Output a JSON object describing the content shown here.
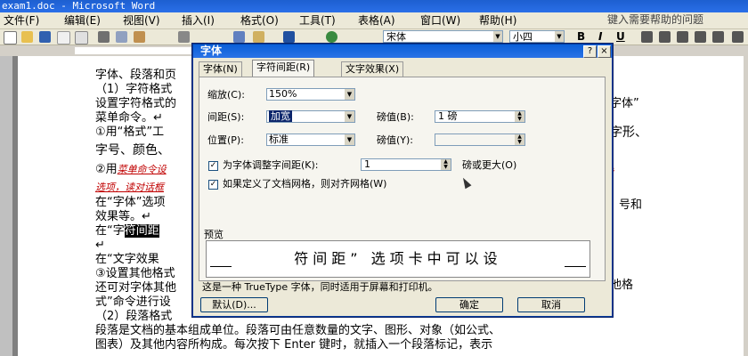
{
  "window": {
    "title": "exam1.doc - Microsoft Word"
  },
  "menu": {
    "items": [
      "文件(F)",
      "编辑(E)",
      "视图(V)",
      "插入(I)",
      "格式(O)",
      "工具(T)",
      "表格(A)",
      "窗口(W)",
      "帮助(H)"
    ],
    "help_placeholder": "键入需要帮助的问题"
  },
  "toolbar": {
    "font": "宋体",
    "size": "小四",
    "bold": "B",
    "italic": "I",
    "underline": "U"
  },
  "document": {
    "lines": [
      "字体、段落和页",
      "（1）字符格式",
      "设置字符格式的",
      "菜单命令。↵",
      "①用“格式”工",
      "字号、颜色、",
      "②用",
      "在“字体”选项",
      "效果等。↵",
      "在“字",
      "↵",
      "在“文字效果",
      "③设置其他格式",
      "还可对字体其他",
      "式”命令进行设",
      "（2）段落格式",
      "段落是文档的基本组成单位。段落可由任意数量的文字、图形、对象（如公式、",
      "图表）及其他内容所构成。每次按下 Enter 键时，就插入一个段落标记，表示"
    ],
    "red_text_1": "菜单命令设",
    "red_text_2": "选项，读对话框",
    "red_text_3": "对",
    "highlight": "符间距",
    "right_bits": [
      "字体”",
      "字形、",
      "号和",
      "他格"
    ]
  },
  "dialog": {
    "title": "字体",
    "help_btn": "?",
    "close_btn": "×",
    "tabs": [
      "字体(N)",
      "字符间距(R)",
      "文字效果(X)"
    ],
    "scale_label": "缩放(C):",
    "scale_value": "150%",
    "spacing_label": "间距(S):",
    "spacing_value": "加宽",
    "spacing_by_label": "磅值(B):",
    "spacing_by_value": "1 磅",
    "position_label": "位置(P):",
    "position_value": "标准",
    "position_by_label": "磅值(Y):",
    "position_by_value": "",
    "kerning_label": "为字体调整字间距(K):",
    "kerning_value": "1",
    "kerning_suffix": "磅或更大(O)",
    "grid_label": "如果定义了文档网格，则对齐网格(W)",
    "preview_label": "预览",
    "preview_text": "符间距” 选项卡中可以设",
    "truetype_note": "这是一种 TrueType 字体，同时适用于屏幕和打印机。",
    "default_btn": "默认(D)...",
    "ok_btn": "确定",
    "cancel_btn": "取消"
  }
}
